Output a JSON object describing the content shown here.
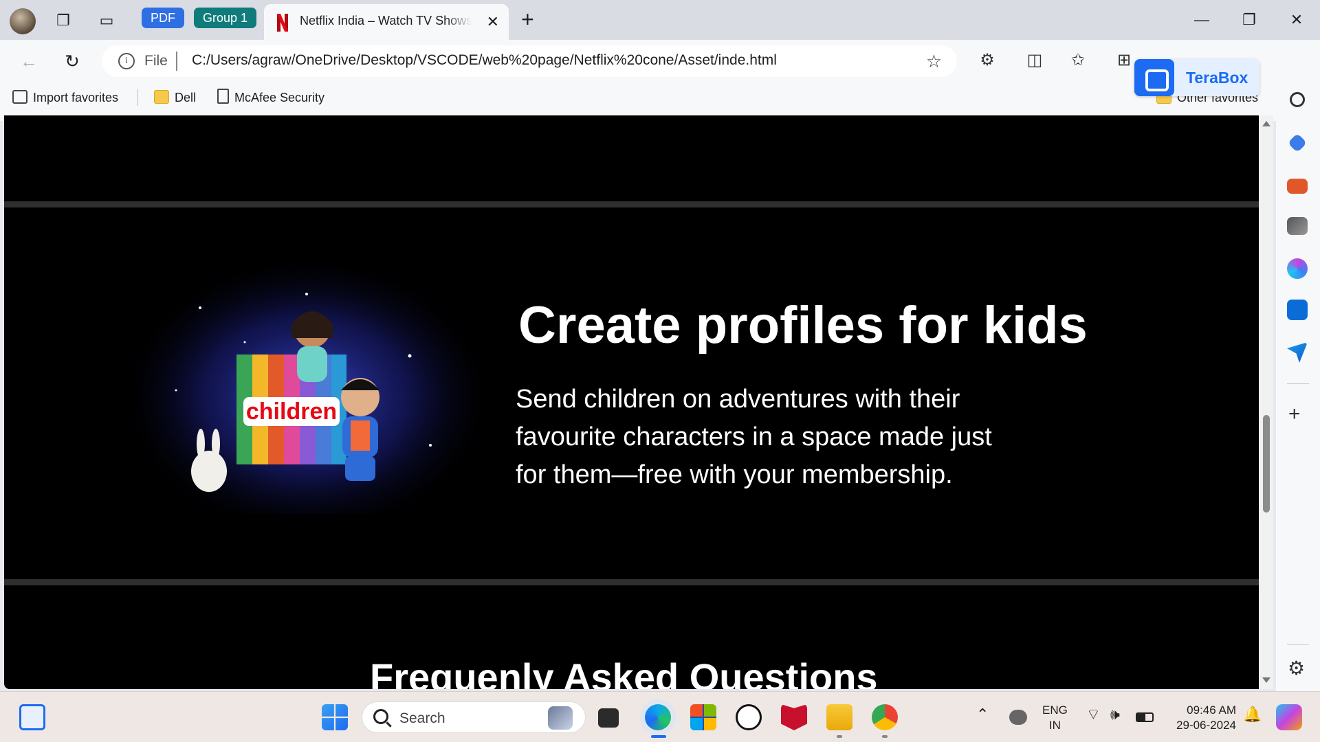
{
  "browser": {
    "tab_groups": [
      {
        "label": "PDF",
        "color": "#2f6fe4"
      },
      {
        "label": "Group 1",
        "color": "#0f7b7b"
      }
    ],
    "active_tab": {
      "title": "Netflix India – Watch TV Shows Online"
    },
    "address": {
      "scheme_label": "File",
      "url": "C:/Users/agraw/OneDrive/Desktop/VSCODE/web%20page/Netflix%20cone/Asset/inde.html"
    },
    "favorites": [
      {
        "label": "Import favorites",
        "icon": "import-icon"
      },
      {
        "label": "Dell",
        "icon": "folder-icon"
      },
      {
        "label": "McAfee Security",
        "icon": "page-icon"
      }
    ],
    "other_favorites": "Other favorites",
    "extension_popup": {
      "label": "TeraBox"
    }
  },
  "page": {
    "kids_section": {
      "title": "Create profiles for kids",
      "body": "Send children on adventures with their favourite characters in a space made just for them—free with your membership.",
      "image_label": "children"
    },
    "faq_title": "Frequenly Asked Questions"
  },
  "taskbar": {
    "search_placeholder": "Search",
    "language": {
      "line1": "ENG",
      "line2": "IN"
    },
    "time": "09:46 AM",
    "date": "29-06-2024"
  },
  "colors": {
    "netflix_red": "#e50914",
    "edge_blue": "#1d6bf3",
    "page_bg": "#000000"
  }
}
